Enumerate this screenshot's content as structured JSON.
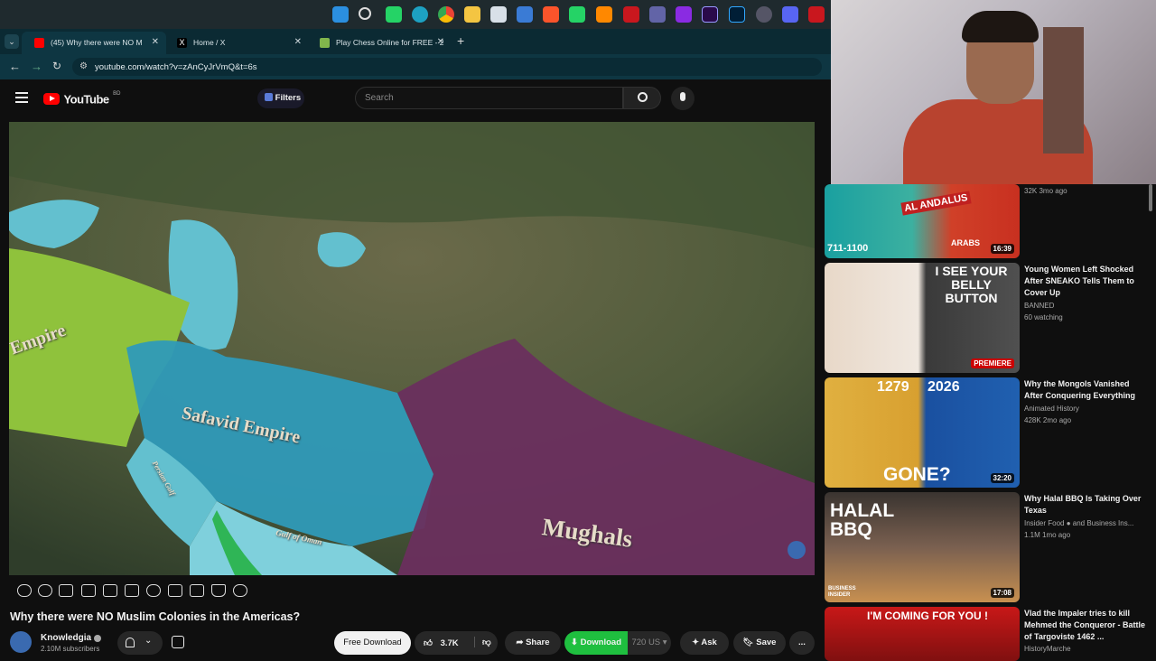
{
  "browser": {
    "tabs": [
      {
        "label": "(45) Why there were NO M"
      },
      {
        "label": "Home / X"
      },
      {
        "label": "Play Chess Online for FREE - 2"
      }
    ],
    "new_tab": "+",
    "url": "youtube.com/watch?v=zAnCyJrVmQ&t=6s"
  },
  "youtube": {
    "logo": "YouTube",
    "region": "BD",
    "filters": "Filters",
    "search_placeholder": "Search"
  },
  "video": {
    "map_labels": {
      "safavid": "Safavid Empire",
      "mughals": "Mughals",
      "empire": "Empire",
      "persian_gulf": "Persian Gulf",
      "gulf_oman": "Gulf of Oman"
    },
    "title": "Why there were NO Muslim Colonies in the Americas?"
  },
  "channel": {
    "name": "Knowledgia",
    "subscribers": "2.10M subscribers"
  },
  "actions": {
    "free_download": "Free Download",
    "likes": "3.7K",
    "share": "Share",
    "download": "Download",
    "quality": "720",
    "quality_suffix": "US",
    "ask": "Ask",
    "save": "Save",
    "more": "..."
  },
  "recommendations": [
    {
      "thumb_text_1": "AL ANDALUS",
      "thumb_text_2": "711-1100",
      "thumb_text_3": "ARABS",
      "duration": "16:39",
      "title": "",
      "channel": "",
      "meta": "32K  3mo ago"
    },
    {
      "thumb_text_1": "I SEE YOUR BELLY BUTTON",
      "badge": "PREMIERE",
      "title": "Young Women Left Shocked After SNEAKO Tells Them to Cover Up",
      "channel": "BANNED",
      "meta": "60 watching"
    },
    {
      "thumb_text_1": "1279",
      "thumb_text_2": "2026",
      "thumb_text_3": "GONE?",
      "duration": "32:20",
      "title": "Why the Mongols Vanished After Conquering Everything",
      "channel": "Animated History",
      "meta": "428K  2mo ago"
    },
    {
      "thumb_text_1": "HALAL BBQ",
      "thumb_text_2": "BUSINESS INSIDER",
      "duration": "17:08",
      "title": "Why Halal BBQ Is Taking Over Texas",
      "channel": "Insider Food",
      "channel_extra": "and Business Ins...",
      "meta": "1.1M  1mo ago"
    },
    {
      "thumb_text_1": "I'M COMING FOR YOU !",
      "title": "Vlad the Impaler tries to kill Mehmed the Conqueror - Battle of Targoviste 1462 ...",
      "channel": "HistoryMarche"
    }
  ],
  "colors": {
    "youtube_red": "#ff0000",
    "download_green": "#1fbf3f",
    "safavid_blue": "#2f9ab8",
    "mughal_purple": "#6a2f5e"
  }
}
